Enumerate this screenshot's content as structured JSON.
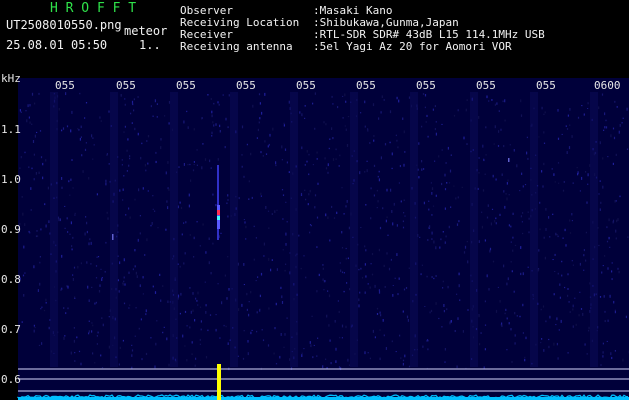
{
  "header": {
    "logo": "H R O F F T",
    "filename": "UT2508010550.png",
    "detector": "meteor",
    "datetime": "25.08.01 05:50",
    "count": "1..",
    "fields": [
      {
        "label": "Observer",
        "value": ":Masaki Kano"
      },
      {
        "label": "Receiving Location",
        "value": ":Shibukawa,Gunma,Japan"
      },
      {
        "label": "Receiver",
        "value": ":RTL-SDR SDR# 43dB L15 114.1MHz USB"
      },
      {
        "label": "Receiving antenna",
        "value": ":5el Yagi Az 20 for Aomori VOR"
      }
    ]
  },
  "axes": {
    "y_unit": "kHz",
    "y_ticks": [
      "1.1",
      "1.0",
      "0.9",
      "0.8",
      "0.7",
      "0.6"
    ],
    "x_ticks": [
      "055",
      "055",
      "055",
      "055",
      "055",
      "055",
      "055",
      "055",
      "055",
      "0600"
    ]
  },
  "colors": {
    "background": "#000000",
    "spectrogram": "#00003a",
    "echo": "#ffff00",
    "baseline": "#00bfff",
    "logo": "#2fe24a"
  }
}
